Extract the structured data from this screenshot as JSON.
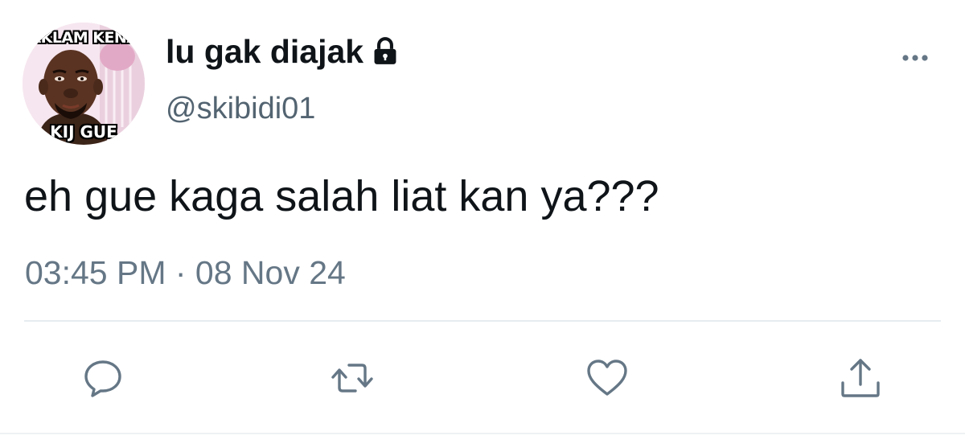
{
  "tweet": {
    "display_name": "lu gak diajak",
    "handle": "@skibidi01",
    "text": "eh gue kaga salah liat kan ya???",
    "timestamp": "03:45 PM · 08 Nov 24",
    "avatar": {
      "caption_top": "AKLAM KENA",
      "caption_bottom": "KIJ GUE"
    },
    "icons": {
      "lock": "lock-icon",
      "more": "more-icon",
      "reply": "reply-icon",
      "retweet": "retweet-icon",
      "like": "like-icon",
      "share": "share-icon"
    }
  },
  "colors": {
    "text": "#0f1419",
    "secondary": "#657786",
    "icon": "#657786",
    "divider": "#e6ecf0",
    "background": "#ffffff"
  }
}
